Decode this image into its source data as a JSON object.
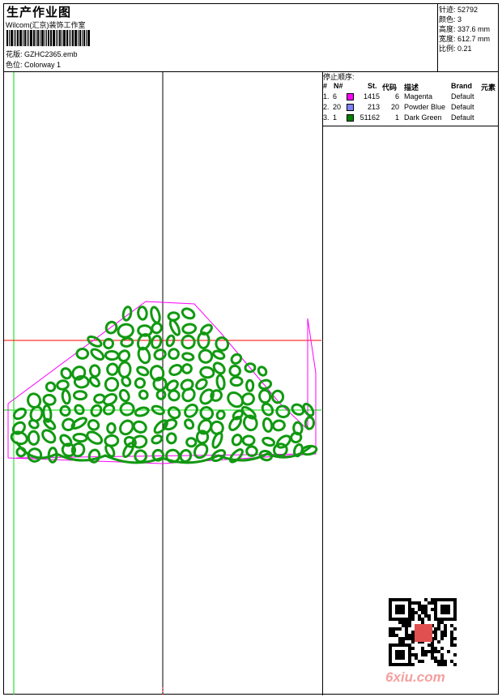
{
  "header": {
    "title": "生产作业图",
    "studio": "Wilcom(汇京)装饰工作室",
    "design_label": "花版:",
    "design_value": "GZHC2365.emb",
    "colorway_label": "色位:",
    "colorway_value": "Colorway 1"
  },
  "info": [
    {
      "label": "针迹:",
      "value": "52792"
    },
    {
      "label": "颜色:",
      "value": "3"
    },
    {
      "label": "高度:",
      "value": "337.6 mm"
    },
    {
      "label": "宽度:",
      "value": "612.7 mm"
    },
    {
      "label": "比例:",
      "value": "0.21"
    }
  ],
  "stop_sequence": {
    "title": "停止顺序:",
    "columns": [
      "#",
      "N#",
      "St.",
      "代码",
      "描述",
      "Brand",
      "元素"
    ],
    "rows": [
      {
        "idx": "1.",
        "n": "6",
        "color": "#ff00ff",
        "st": "1415",
        "code": "6",
        "desc": "Magenta",
        "brand": "Default"
      },
      {
        "idx": "2.",
        "n": "20",
        "color": "#8080ff",
        "st": "213",
        "code": "20",
        "desc": "Powder Blue",
        "brand": "Default"
      },
      {
        "idx": "3.",
        "n": "1",
        "color": "#008000",
        "st": "51162",
        "code": "1",
        "desc": "Dark Green",
        "brand": "Default"
      }
    ]
  },
  "watermark": {
    "text": "6xiu.com"
  },
  "colors": {
    "embroidery": "#119911",
    "outline": "#ff00ff",
    "guide_red": "#ff0000",
    "guide_green": "#00dd00"
  }
}
